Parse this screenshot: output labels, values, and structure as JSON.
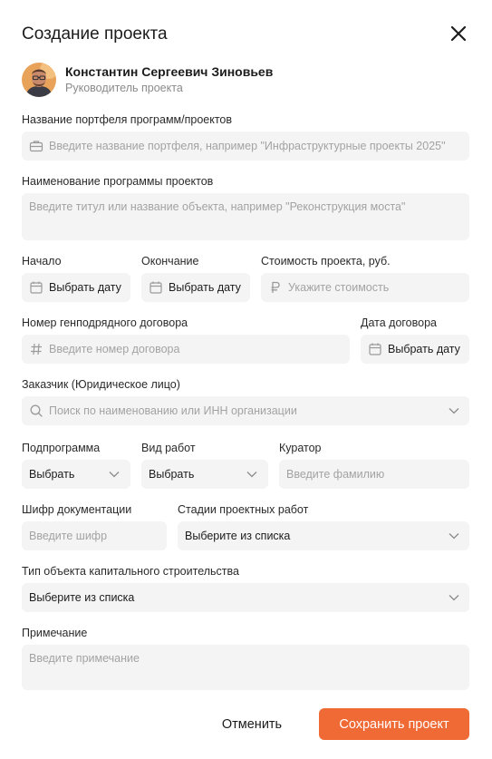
{
  "dialog": {
    "title": "Создание проекта",
    "close_icon": "close-icon"
  },
  "user": {
    "name": "Константин Сергеевич Зиновьев",
    "role": "Руководитель проекта"
  },
  "form": {
    "portfolio": {
      "label": "Название портфеля программ/проектов",
      "placeholder": "Введите название портфеля, например \"Инфраструктурные проекты 2025\"",
      "icon": "briefcase-icon"
    },
    "program": {
      "label": "Наименование программы проектов",
      "placeholder": "Введите титул или название объекта, например \"Реконструкция моста\""
    },
    "start": {
      "label": "Начало",
      "placeholder": "Выбрать дату",
      "icon": "calendar-icon"
    },
    "end": {
      "label": "Окончание",
      "placeholder": "Выбрать дату",
      "icon": "calendar-icon"
    },
    "cost": {
      "label": "Стоимость проекта, руб.",
      "placeholder": "Укажите стоимость",
      "icon": "ruble-icon"
    },
    "contract_number": {
      "label": "Номер генподрядного договора",
      "placeholder": "Введите номер договора",
      "icon": "hash-icon"
    },
    "contract_date": {
      "label": "Дата договора",
      "placeholder": "Выбрать дату",
      "icon": "calendar-icon"
    },
    "customer": {
      "label": "Заказчик (Юридическое лицо)",
      "placeholder": "Поиск по наименованию или ИНН организации",
      "icon": "search-icon"
    },
    "subprogram": {
      "label": "Подпрограмма",
      "placeholder": "Выбрать"
    },
    "work_type": {
      "label": "Вид работ",
      "placeholder": "Выбрать"
    },
    "curator": {
      "label": "Куратор",
      "placeholder": "Введите фамилию"
    },
    "doc_code": {
      "label": "Шифр документации",
      "placeholder": "Введите шифр"
    },
    "stages": {
      "label": "Стадии проектных работ",
      "placeholder": "Выберите из списка"
    },
    "object_type": {
      "label": "Тип объекта капитального строительства",
      "placeholder": "Выберите из списка"
    },
    "note": {
      "label": "Примечание",
      "placeholder": "Введите примечание"
    }
  },
  "actions": {
    "cancel": "Отменить",
    "save": "Сохранить проект"
  },
  "colors": {
    "accent": "#f06a35",
    "field_bg": "#f4f4f5",
    "placeholder": "#a3a3a3"
  }
}
